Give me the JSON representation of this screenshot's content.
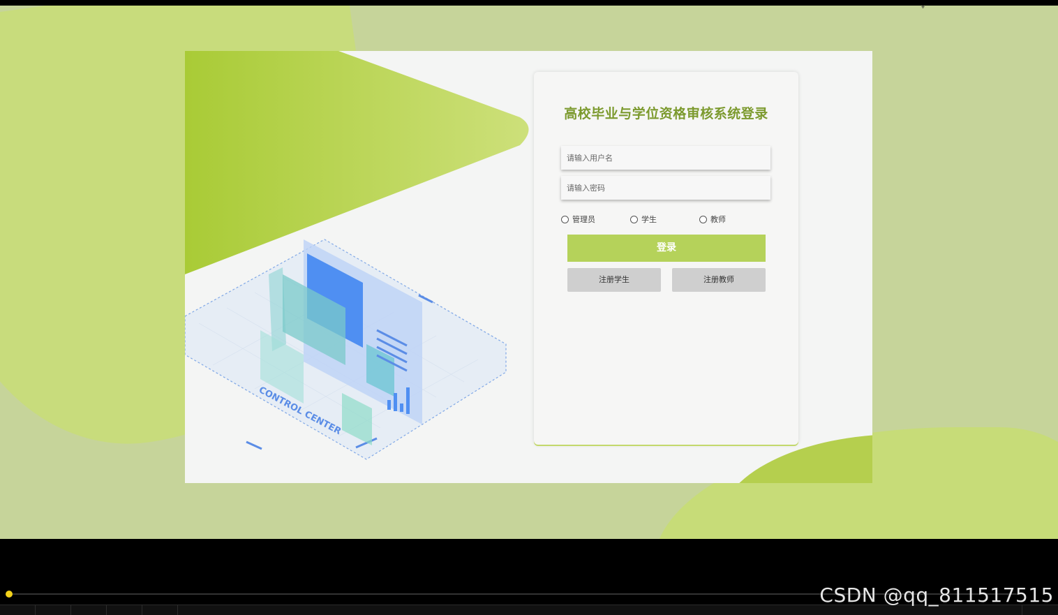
{
  "login": {
    "title": "高校毕业与学位资格审核系统登录",
    "username_placeholder": "请输入用户名",
    "password_placeholder": "请输入密码",
    "roles": [
      "管理员",
      "学生",
      "教师"
    ],
    "login_label": "登录",
    "register_student_label": "注册学生",
    "register_teacher_label": "注册教师"
  },
  "illustration": {
    "caption": "CONTROL CENTER"
  },
  "player": {
    "watermark": "CSDN @qq_811517515"
  },
  "colors": {
    "accent": "#b5d25a",
    "title": "#7c9a2e",
    "background": "#c6d49a"
  }
}
